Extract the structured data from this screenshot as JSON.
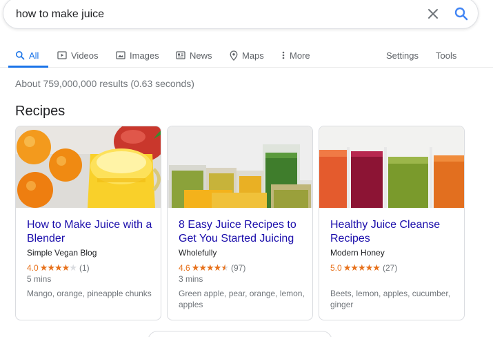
{
  "search": {
    "query": "how to make juice"
  },
  "tabs": [
    {
      "label": "All",
      "icon": "search-icon"
    },
    {
      "label": "Videos",
      "icon": "video-icon"
    },
    {
      "label": "Images",
      "icon": "image-icon"
    },
    {
      "label": "News",
      "icon": "news-icon"
    },
    {
      "label": "Maps",
      "icon": "map-pin-icon"
    },
    {
      "label": "More",
      "icon": "more-vert-icon"
    }
  ],
  "tools": {
    "settings": "Settings",
    "tools": "Tools"
  },
  "results": {
    "stats": "About 759,000,000 results (0.63 seconds)"
  },
  "recipes": {
    "heading": "Recipes",
    "cards": [
      {
        "title": "How to Make Juice with a Blender",
        "source": "Simple Vegan Blog",
        "rating": "4.0",
        "stars": 4,
        "reviews": "(1)",
        "time": "5 mins",
        "ingredients": "Mango, orange, pineapple chunks"
      },
      {
        "title": "8 Easy Juice Recipes to Get You Started Juicing",
        "source": "Wholefully",
        "rating": "4.6",
        "stars": 4.6,
        "reviews": "(97)",
        "time": "3 mins",
        "ingredients": "Green apple, pear, orange, lemon, apples"
      },
      {
        "title": "Healthy Juice Cleanse Recipes",
        "source": "Modern Honey",
        "rating": "5.0",
        "stars": 5,
        "reviews": "(27)",
        "time": "",
        "ingredients": "Beets, lemon, apples, cucumber, ginger"
      }
    ]
  },
  "colors": {
    "accent": "#1a73e8",
    "link": "#1a0dab",
    "star": "#e7711b",
    "muted": "#70757a"
  }
}
